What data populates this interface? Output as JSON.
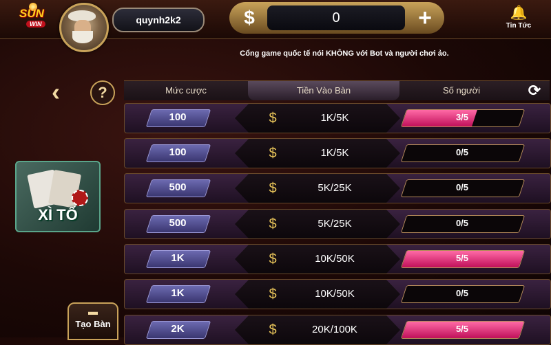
{
  "brand": {
    "logo_text": "SUN",
    "logo_sub": "WIN"
  },
  "user": {
    "name": "quynh2k2"
  },
  "balance": {
    "currency_symbol": "$",
    "value": "0",
    "add_symbol": "+"
  },
  "news": {
    "label": "Tin Tức"
  },
  "notice": "Cổng game quốc tế nói KHÔNG với Bot và người chơi ảo.",
  "nav": {
    "back_symbol": "‹",
    "help_symbol": "?"
  },
  "game": {
    "title": "XÌ TỐ"
  },
  "create_room": {
    "label": "Tạo Bàn"
  },
  "table": {
    "columns": [
      "Mức cược",
      "Tiền Vào Bàn",
      "Số người"
    ],
    "refresh_symbol": "⟳",
    "rows": [
      {
        "bet": "100",
        "entry": "1K/5K",
        "players": "3/5",
        "fill": 0.6
      },
      {
        "bet": "100",
        "entry": "1K/5K",
        "players": "0/5",
        "fill": 0
      },
      {
        "bet": "500",
        "entry": "5K/25K",
        "players": "0/5",
        "fill": 0
      },
      {
        "bet": "500",
        "entry": "5K/25K",
        "players": "0/5",
        "fill": 0
      },
      {
        "bet": "1K",
        "entry": "10K/50K",
        "players": "5/5",
        "fill": 1.0
      },
      {
        "bet": "1K",
        "entry": "10K/50K",
        "players": "0/5",
        "fill": 0
      },
      {
        "bet": "2K",
        "entry": "20K/100K",
        "players": "5/5",
        "fill": 1.0
      }
    ]
  },
  "colors": {
    "accent_gold": "#c9a35a",
    "player_fill": "#e0207a",
    "bet_badge": "#5a57a0"
  }
}
